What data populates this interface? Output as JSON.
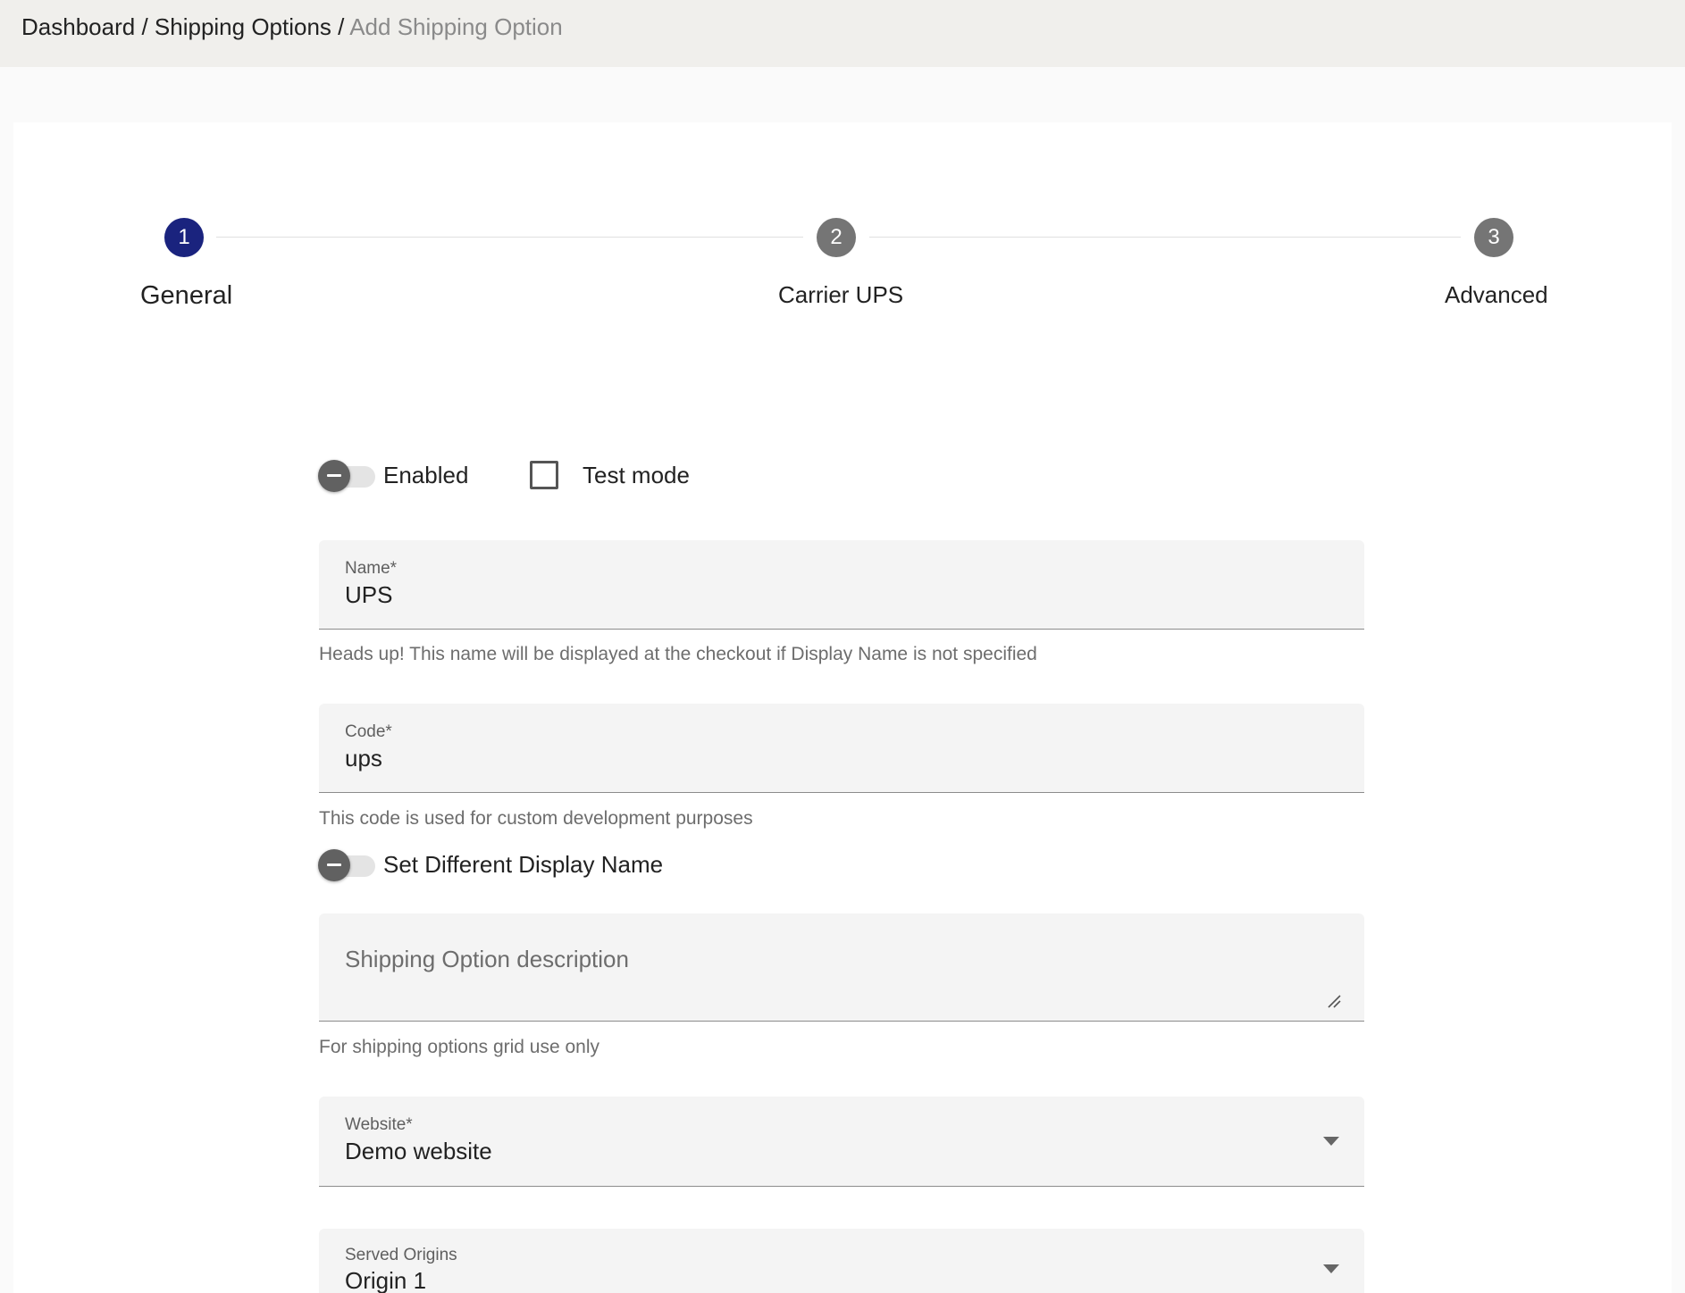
{
  "breadcrumb": {
    "items": [
      "Dashboard",
      "Shipping Options"
    ],
    "separator": "/",
    "current": "Add Shipping Option"
  },
  "stepper": {
    "steps": [
      {
        "number": "1",
        "label": "General",
        "state": "active"
      },
      {
        "number": "2",
        "label": "Carrier UPS",
        "state": "inactive"
      },
      {
        "number": "3",
        "label": "Advanced",
        "state": "inactive"
      }
    ],
    "active_color": "#1a237e",
    "inactive_color": "#757575"
  },
  "form": {
    "enabled": {
      "label": "Enabled",
      "checked": false
    },
    "test_mode": {
      "label": "Test mode",
      "checked": false
    },
    "name": {
      "label": "Name*",
      "value": "UPS",
      "hint": "Heads up! This name will be displayed at the checkout if Display Name is not specified"
    },
    "code": {
      "label": "Code*",
      "value": "ups",
      "hint": "This code is used for custom development purposes"
    },
    "display_name_toggle": {
      "label": "Set Different Display Name",
      "checked": false
    },
    "description": {
      "placeholder": "Shipping Option description",
      "hint": "For shipping options grid use only"
    },
    "website": {
      "label": "Website*",
      "value": "Demo website"
    },
    "served_origins": {
      "label": "Served Origins",
      "value": "Origin 1"
    }
  }
}
